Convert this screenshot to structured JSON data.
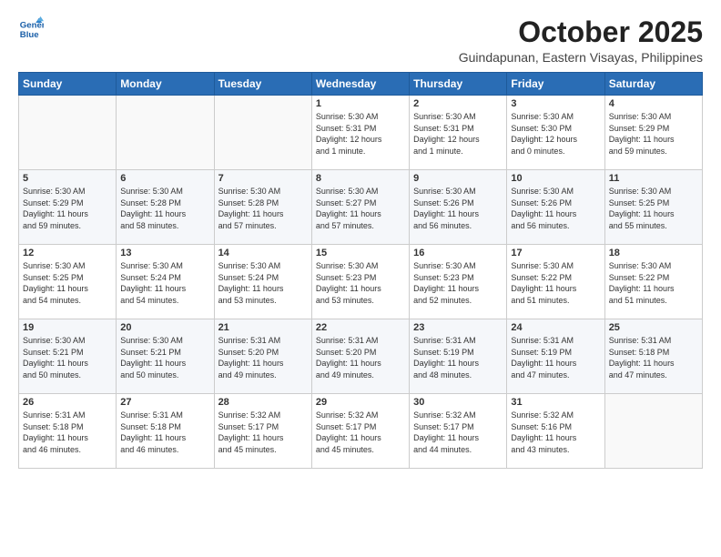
{
  "logo": {
    "line1": "General",
    "line2": "Blue"
  },
  "title": "October 2025",
  "subtitle": "Guindapunan, Eastern Visayas, Philippines",
  "headers": [
    "Sunday",
    "Monday",
    "Tuesday",
    "Wednesday",
    "Thursday",
    "Friday",
    "Saturday"
  ],
  "weeks": [
    [
      {
        "day": "",
        "info": ""
      },
      {
        "day": "",
        "info": ""
      },
      {
        "day": "",
        "info": ""
      },
      {
        "day": "1",
        "info": "Sunrise: 5:30 AM\nSunset: 5:31 PM\nDaylight: 12 hours\nand 1 minute."
      },
      {
        "day": "2",
        "info": "Sunrise: 5:30 AM\nSunset: 5:31 PM\nDaylight: 12 hours\nand 1 minute."
      },
      {
        "day": "3",
        "info": "Sunrise: 5:30 AM\nSunset: 5:30 PM\nDaylight: 12 hours\nand 0 minutes."
      },
      {
        "day": "4",
        "info": "Sunrise: 5:30 AM\nSunset: 5:29 PM\nDaylight: 11 hours\nand 59 minutes."
      }
    ],
    [
      {
        "day": "5",
        "info": "Sunrise: 5:30 AM\nSunset: 5:29 PM\nDaylight: 11 hours\nand 59 minutes."
      },
      {
        "day": "6",
        "info": "Sunrise: 5:30 AM\nSunset: 5:28 PM\nDaylight: 11 hours\nand 58 minutes."
      },
      {
        "day": "7",
        "info": "Sunrise: 5:30 AM\nSunset: 5:28 PM\nDaylight: 11 hours\nand 57 minutes."
      },
      {
        "day": "8",
        "info": "Sunrise: 5:30 AM\nSunset: 5:27 PM\nDaylight: 11 hours\nand 57 minutes."
      },
      {
        "day": "9",
        "info": "Sunrise: 5:30 AM\nSunset: 5:26 PM\nDaylight: 11 hours\nand 56 minutes."
      },
      {
        "day": "10",
        "info": "Sunrise: 5:30 AM\nSunset: 5:26 PM\nDaylight: 11 hours\nand 56 minutes."
      },
      {
        "day": "11",
        "info": "Sunrise: 5:30 AM\nSunset: 5:25 PM\nDaylight: 11 hours\nand 55 minutes."
      }
    ],
    [
      {
        "day": "12",
        "info": "Sunrise: 5:30 AM\nSunset: 5:25 PM\nDaylight: 11 hours\nand 54 minutes."
      },
      {
        "day": "13",
        "info": "Sunrise: 5:30 AM\nSunset: 5:24 PM\nDaylight: 11 hours\nand 54 minutes."
      },
      {
        "day": "14",
        "info": "Sunrise: 5:30 AM\nSunset: 5:24 PM\nDaylight: 11 hours\nand 53 minutes."
      },
      {
        "day": "15",
        "info": "Sunrise: 5:30 AM\nSunset: 5:23 PM\nDaylight: 11 hours\nand 53 minutes."
      },
      {
        "day": "16",
        "info": "Sunrise: 5:30 AM\nSunset: 5:23 PM\nDaylight: 11 hours\nand 52 minutes."
      },
      {
        "day": "17",
        "info": "Sunrise: 5:30 AM\nSunset: 5:22 PM\nDaylight: 11 hours\nand 51 minutes."
      },
      {
        "day": "18",
        "info": "Sunrise: 5:30 AM\nSunset: 5:22 PM\nDaylight: 11 hours\nand 51 minutes."
      }
    ],
    [
      {
        "day": "19",
        "info": "Sunrise: 5:30 AM\nSunset: 5:21 PM\nDaylight: 11 hours\nand 50 minutes."
      },
      {
        "day": "20",
        "info": "Sunrise: 5:30 AM\nSunset: 5:21 PM\nDaylight: 11 hours\nand 50 minutes."
      },
      {
        "day": "21",
        "info": "Sunrise: 5:31 AM\nSunset: 5:20 PM\nDaylight: 11 hours\nand 49 minutes."
      },
      {
        "day": "22",
        "info": "Sunrise: 5:31 AM\nSunset: 5:20 PM\nDaylight: 11 hours\nand 49 minutes."
      },
      {
        "day": "23",
        "info": "Sunrise: 5:31 AM\nSunset: 5:19 PM\nDaylight: 11 hours\nand 48 minutes."
      },
      {
        "day": "24",
        "info": "Sunrise: 5:31 AM\nSunset: 5:19 PM\nDaylight: 11 hours\nand 47 minutes."
      },
      {
        "day": "25",
        "info": "Sunrise: 5:31 AM\nSunset: 5:18 PM\nDaylight: 11 hours\nand 47 minutes."
      }
    ],
    [
      {
        "day": "26",
        "info": "Sunrise: 5:31 AM\nSunset: 5:18 PM\nDaylight: 11 hours\nand 46 minutes."
      },
      {
        "day": "27",
        "info": "Sunrise: 5:31 AM\nSunset: 5:18 PM\nDaylight: 11 hours\nand 46 minutes."
      },
      {
        "day": "28",
        "info": "Sunrise: 5:32 AM\nSunset: 5:17 PM\nDaylight: 11 hours\nand 45 minutes."
      },
      {
        "day": "29",
        "info": "Sunrise: 5:32 AM\nSunset: 5:17 PM\nDaylight: 11 hours\nand 45 minutes."
      },
      {
        "day": "30",
        "info": "Sunrise: 5:32 AM\nSunset: 5:17 PM\nDaylight: 11 hours\nand 44 minutes."
      },
      {
        "day": "31",
        "info": "Sunrise: 5:32 AM\nSunset: 5:16 PM\nDaylight: 11 hours\nand 43 minutes."
      },
      {
        "day": "",
        "info": ""
      }
    ]
  ]
}
